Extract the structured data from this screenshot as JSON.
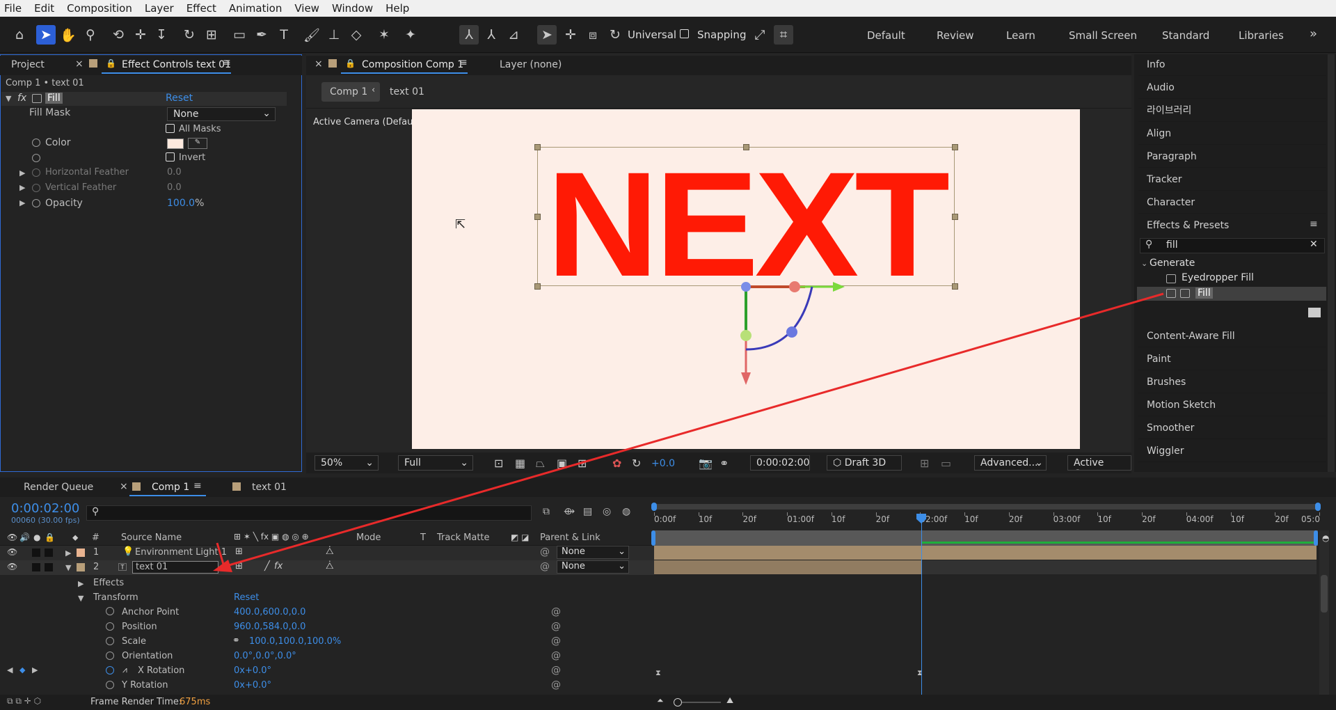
{
  "menu": [
    "File",
    "Edit",
    "Composition",
    "Layer",
    "Effect",
    "Animation",
    "View",
    "Window",
    "Help"
  ],
  "toolbar": {
    "universal": "Universal",
    "snapping": "Snapping"
  },
  "workspaces": [
    "Default",
    "Review",
    "Learn",
    "Small Screen",
    "Standard",
    "Libraries"
  ],
  "left_panel": {
    "tab_project": "Project",
    "tab_effect": "Effect Controls text 01",
    "breadcrumb": "Comp 1 • text 01",
    "effect_fx": "fx",
    "effect_name": "Fill",
    "reset": "Reset",
    "fill_mask_label": "Fill Mask",
    "fill_mask_value": "None",
    "all_masks": "All Masks",
    "color_label": "Color",
    "color_swatch": "#fde9de",
    "invert": "Invert",
    "hfeather_label": "Horizontal Feather",
    "hfeather_value": "0.0",
    "vfeather_label": "Vertical Feather",
    "vfeather_value": "0.0",
    "opacity_label": "Opacity",
    "opacity_value": "100.0",
    "opacity_unit": "%"
  },
  "comp_panel": {
    "tab_comp": "Composition Comp 1",
    "tab_layer": "Layer (none)",
    "crumb_comp": "Comp 1",
    "crumb_layer": "text 01",
    "camera": "Active Camera (Default)",
    "text": "NEXT",
    "text_color": "#ff1a05",
    "bg_color": "#fdeee7",
    "zoom": "50%",
    "quality": "Full",
    "exposure": "+0.0",
    "timecode": "0:00:02:00",
    "renderer": "Draft 3D",
    "advanced": "Advanced...",
    "view": "Active Came..."
  },
  "right_panel": {
    "items_top": [
      "Info",
      "Audio",
      "라이브러리",
      "Align",
      "Paragraph",
      "Tracker",
      "Character",
      "Effects & Presets"
    ],
    "search_value": "fill",
    "category": "Generate",
    "results": [
      "Eyedropper Fill",
      "Fill"
    ],
    "items_bottom": [
      "Content-Aware Fill",
      "Paint",
      "Brushes",
      "Motion Sketch",
      "Smoother",
      "Wiggler"
    ]
  },
  "timeline": {
    "tab_render": "Render Queue",
    "tab_comp": "Comp 1",
    "tab_text": "text 01",
    "timecode": "0:00:02:00",
    "frames": "00060 (30.00 fps)",
    "col_num": "#",
    "col_source": "Source Name",
    "col_mode": "Mode",
    "col_t": "T",
    "col_track": "Track Matte",
    "col_parent": "Parent & Link",
    "ruler": [
      "0:00f",
      "10f",
      "20f",
      "01:00f",
      "10f",
      "20f",
      "02:00f",
      "10f",
      "20f",
      "03:00f",
      "10f",
      "20f",
      "04:00f",
      "10f",
      "20f",
      "05:0"
    ],
    "layers": [
      {
        "num": "1",
        "name": "Environment Light 1",
        "parent": "None"
      },
      {
        "num": "2",
        "name": "text 01",
        "parent": "None"
      }
    ],
    "effects_label": "Effects",
    "transform_label": "Transform",
    "reset": "Reset",
    "props": [
      {
        "name": "Anchor Point",
        "value": "400.0,600.0,0.0"
      },
      {
        "name": "Position",
        "value": "960.0,584.0,0.0"
      },
      {
        "name": "Scale",
        "value": "100.0,100.0,100.0%"
      },
      {
        "name": "Orientation",
        "value": "0.0°,0.0°,0.0°"
      },
      {
        "name": "X Rotation",
        "value": "0x+0.0°"
      },
      {
        "name": "Y Rotation",
        "value": "0x+0.0°"
      }
    ],
    "frame_render_label": "Frame Render Time:",
    "frame_render_value": "675ms"
  }
}
